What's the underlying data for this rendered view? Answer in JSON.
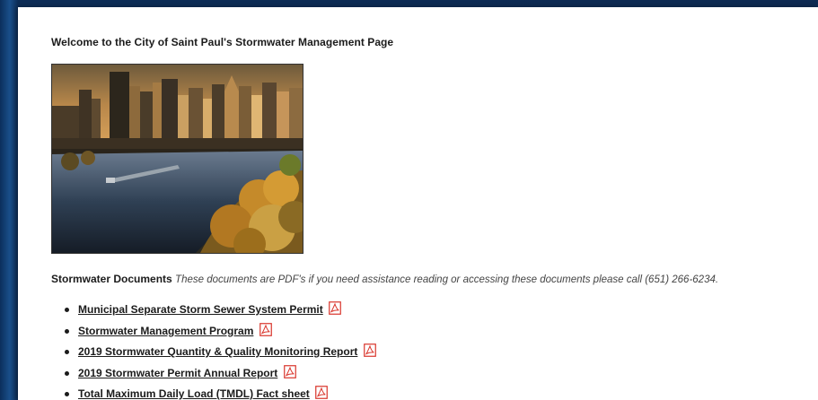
{
  "page": {
    "welcome": "Welcome to the City of Saint Paul's Stormwater Management Page"
  },
  "documents": {
    "heading": "Stormwater Documents",
    "note": "These documents are PDF's if you need assistance reading or accessing these documents please call (651) 266-6234.",
    "items": [
      {
        "label": "Municipal Separate Storm Sewer System Permit",
        "icon": "pdf-icon"
      },
      {
        "label": "Stormwater Management Program",
        "icon": "pdf-icon"
      },
      {
        "label": "2019 Stormwater Quantity & Quality Monitoring Report",
        "icon": "pdf-icon"
      },
      {
        "label": "2019 Stormwater Permit Annual Report",
        "icon": "pdf-icon"
      },
      {
        "label": "Total Maximum Daily Load (TMDL) Fact sheet",
        "icon": "pdf-icon"
      }
    ]
  },
  "colors": {
    "pdf_red": "#d9342b",
    "text": "#1b1b1b",
    "frame_blue": "#0e2a52"
  }
}
